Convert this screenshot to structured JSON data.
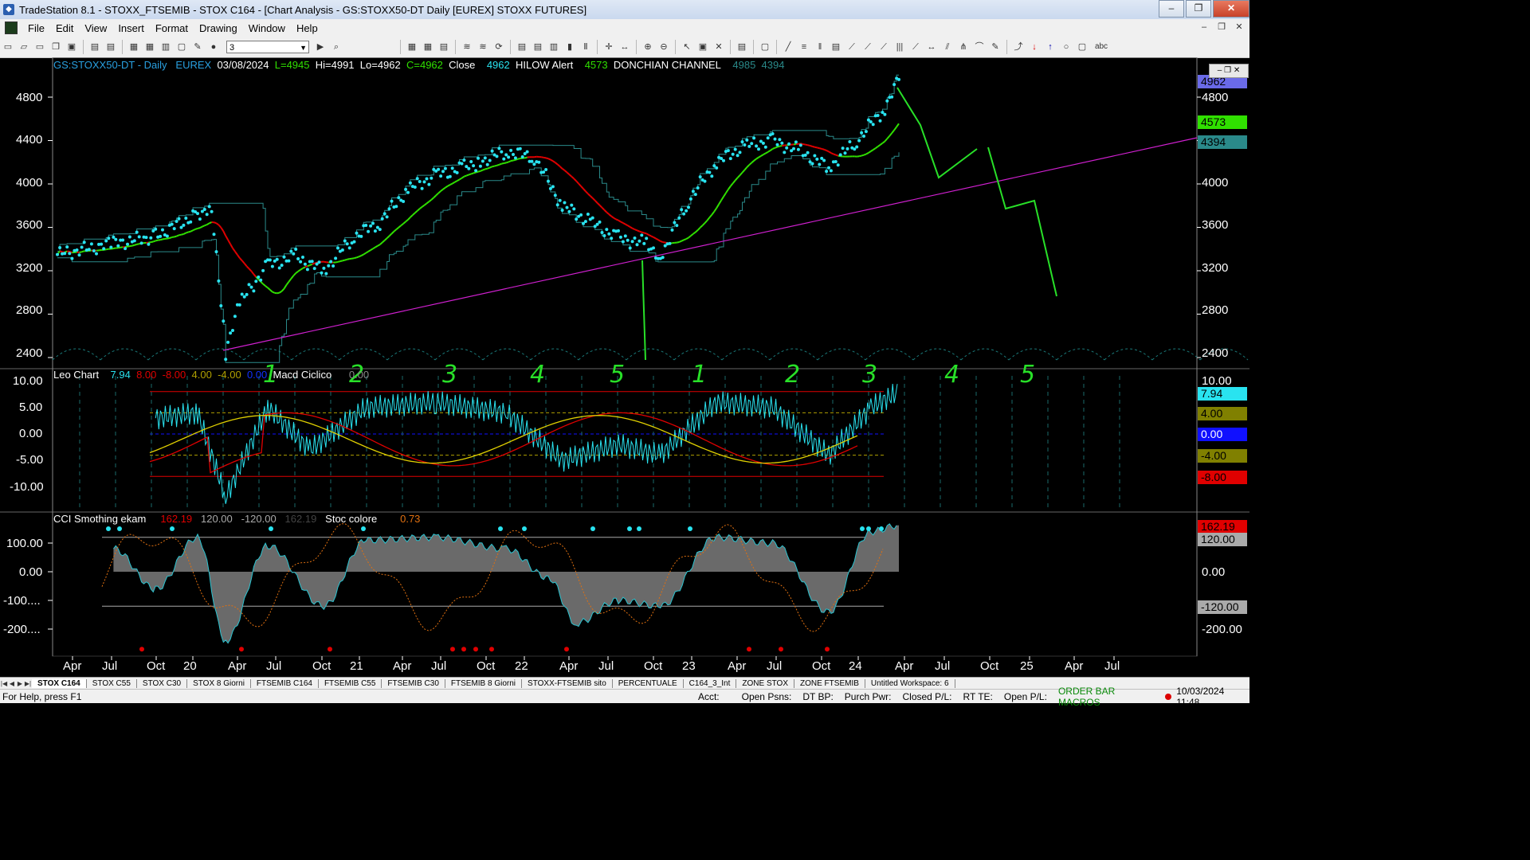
{
  "window": {
    "title": "TradeStation 8.1 - STOXX_FTSEMIB - STOX C164 - [Chart Analysis - GS:STOXX50-DT  Daily  [EUREX] STOXX FUTURES]",
    "minimize": "–",
    "maximize": "❐",
    "close": "✕"
  },
  "menu": [
    "File",
    "Edit",
    "View",
    "Insert",
    "Format",
    "Drawing",
    "Window",
    "Help"
  ],
  "toolbar": {
    "combo_value": "3"
  },
  "header": {
    "symbol": "GS:STOXX50-DT - Daily",
    "exchange": "EUREX",
    "date": "03/08/2024",
    "low_open": "L=4945",
    "hi": "Hi=4991",
    "lo": "Lo=4962",
    "close": "C=4962",
    "close_label": "Close",
    "close_value": "4962",
    "hilow_label": "HILOW Alert",
    "hilow_value": "4573",
    "donchian_label": "DONCHIAN CHANNEL",
    "donchian_hi": "4985",
    "donchian_lo": "4394"
  },
  "price_axis": {
    "ticks": [
      "4800",
      "4400",
      "4000",
      "3600",
      "3200",
      "2800",
      "2400"
    ],
    "tags": {
      "last": "4962",
      "top_label": "4800",
      "hilow": "4573",
      "donchian_lo": "4394"
    }
  },
  "leo_panel": {
    "title": "Leo Chart",
    "values": [
      "7.94",
      "8.00",
      "-8.00",
      "4.00",
      "-4.00",
      "0.00"
    ],
    "macd_label": "Macd Ciclico",
    "macd_value": "0.00",
    "ticks": [
      "10.00",
      "5.00",
      "0.00",
      "-5.00",
      "-10.00"
    ],
    "tags": [
      "10.00",
      "7.94",
      "5.00",
      "4.00",
      "0.00",
      "-4.00",
      "-8.00",
      "-10.00"
    ]
  },
  "cci_panel": {
    "title": "CCI Smothing ekam",
    "values": [
      "162.19",
      "120.00",
      "-120.00",
      "162.19"
    ],
    "stoc_label": "Stoc colore",
    "stoc_value": "0.73",
    "ticks": [
      "100.00",
      "0.00",
      "-100....",
      "-200...."
    ],
    "tags": [
      "162.19",
      "120.00",
      "0.00",
      "-100.00",
      "-120.00",
      "-200.00"
    ]
  },
  "time_axis": [
    "Apr",
    "Jul",
    "Oct",
    "20",
    "Apr",
    "Jul",
    "Oct",
    "21",
    "Apr",
    "Jul",
    "Oct",
    "22",
    "Apr",
    "Jul",
    "Oct",
    "23",
    "Apr",
    "Jul",
    "Oct",
    "24",
    "Apr",
    "Jul",
    "Oct",
    "25",
    "Apr",
    "Jul"
  ],
  "annotations": [
    "1",
    "2",
    "3",
    "4",
    "5",
    "1",
    "2",
    "3",
    "4",
    "5"
  ],
  "tabs": [
    "STOX C164",
    "STOX C55",
    "STOX  C30",
    "STOX  8 Giorni",
    "FTSEMIB C164",
    "FTSEMIB C55",
    "FTSEMIB C30",
    "FTSEMIB  8 Giorni",
    "STOXX-FTSEMIB sito",
    "PERCENTUALE",
    "C164_3_Int",
    "ZONE STOX",
    "ZONE FTSEMIB",
    "Untitled Workspace:  6"
  ],
  "status": {
    "help": "For Help, press F1",
    "fields": [
      "Acct:",
      "Open Psns:",
      "DT BP:",
      "Purch Pwr:",
      "Closed P/L:",
      "RT TE:",
      "Open P/L:"
    ],
    "macros": "ORDER BAR  MACROS",
    "datetime": "10/03/2024 11:48"
  },
  "colors": {
    "price_dots": "#29e3f0",
    "ma_green": "#30e000",
    "ma_red": "#e00000",
    "donchian": "#2a8a8a",
    "trendline": "#d020d0",
    "drawing": "#28e028"
  },
  "chart_data": [
    {
      "type": "line",
      "title": "GS:STOXX50-DT - Daily",
      "ylim": [
        2200,
        5050
      ],
      "series": [
        {
          "name": "Close",
          "x": [
            "2019-03",
            "2019-07",
            "2019-10",
            "2020-01",
            "2020-02",
            "2020-03",
            "2020-04",
            "2020-06",
            "2020-08",
            "2020-10",
            "2020-12",
            "2021-02",
            "2021-04",
            "2021-06",
            "2021-08",
            "2021-09",
            "2021-11",
            "2022-01",
            "2022-03",
            "2022-05",
            "2022-07",
            "2022-09",
            "2022-10",
            "2022-12",
            "2023-02",
            "2023-04",
            "2023-06",
            "2023-08",
            "2023-10",
            "2023-12",
            "2024-02",
            "2024-03"
          ],
          "values": [
            3350,
            3450,
            3520,
            3720,
            3800,
            2450,
            2900,
            3250,
            3330,
            3200,
            3500,
            3650,
            3950,
            4080,
            4150,
            4200,
            4300,
            4250,
            3800,
            3650,
            3500,
            3450,
            3330,
            3850,
            4200,
            4350,
            4400,
            4300,
            4150,
            4400,
            4700,
            4962
          ]
        },
        {
          "name": "HILOW Alert",
          "value": 4573
        },
        {
          "name": "DONCHIAN CHANNEL",
          "values": [
            4985,
            4394
          ]
        }
      ]
    },
    {
      "type": "line",
      "title": "Leo Chart",
      "ylim": [
        -13,
        12
      ],
      "series": [
        {
          "name": "Leo Chart",
          "x": [
            "2019-10",
            "2020-01",
            "2020-03",
            "2020-06",
            "2020-09",
            "2021-01",
            "2021-06",
            "2021-11",
            "2022-03",
            "2022-07",
            "2022-10",
            "2023-02",
            "2023-06",
            "2023-10",
            "2024-01",
            "2024-03"
          ],
          "values": [
            3,
            4,
            -12,
            5,
            -3,
            5,
            6,
            4,
            -5,
            -2,
            -4,
            6,
            5,
            -4,
            5,
            7.94
          ]
        },
        {
          "name": "Macd Ciclico",
          "value": 0.0
        }
      ]
    },
    {
      "type": "area",
      "title": "CCI Smothing ekam",
      "ylim": [
        -250,
        200
      ],
      "series": [
        {
          "name": "CCI Smothing ekam",
          "x": [
            "2019-07",
            "2019-10",
            "2020-01",
            "2020-03",
            "2020-06",
            "2020-10",
            "2021-01",
            "2021-06",
            "2021-11",
            "2022-02",
            "2022-04",
            "2022-07",
            "2022-10",
            "2023-02",
            "2023-06",
            "2023-10",
            "2024-01",
            "2024-03"
          ],
          "values": [
            80,
            -60,
            120,
            -240,
            90,
            -120,
            110,
            120,
            80,
            -20,
            -180,
            -100,
            -120,
            120,
            100,
            -140,
            140,
            162.19
          ]
        },
        {
          "name": "Stoc colore",
          "value": 0.73
        }
      ]
    }
  ]
}
